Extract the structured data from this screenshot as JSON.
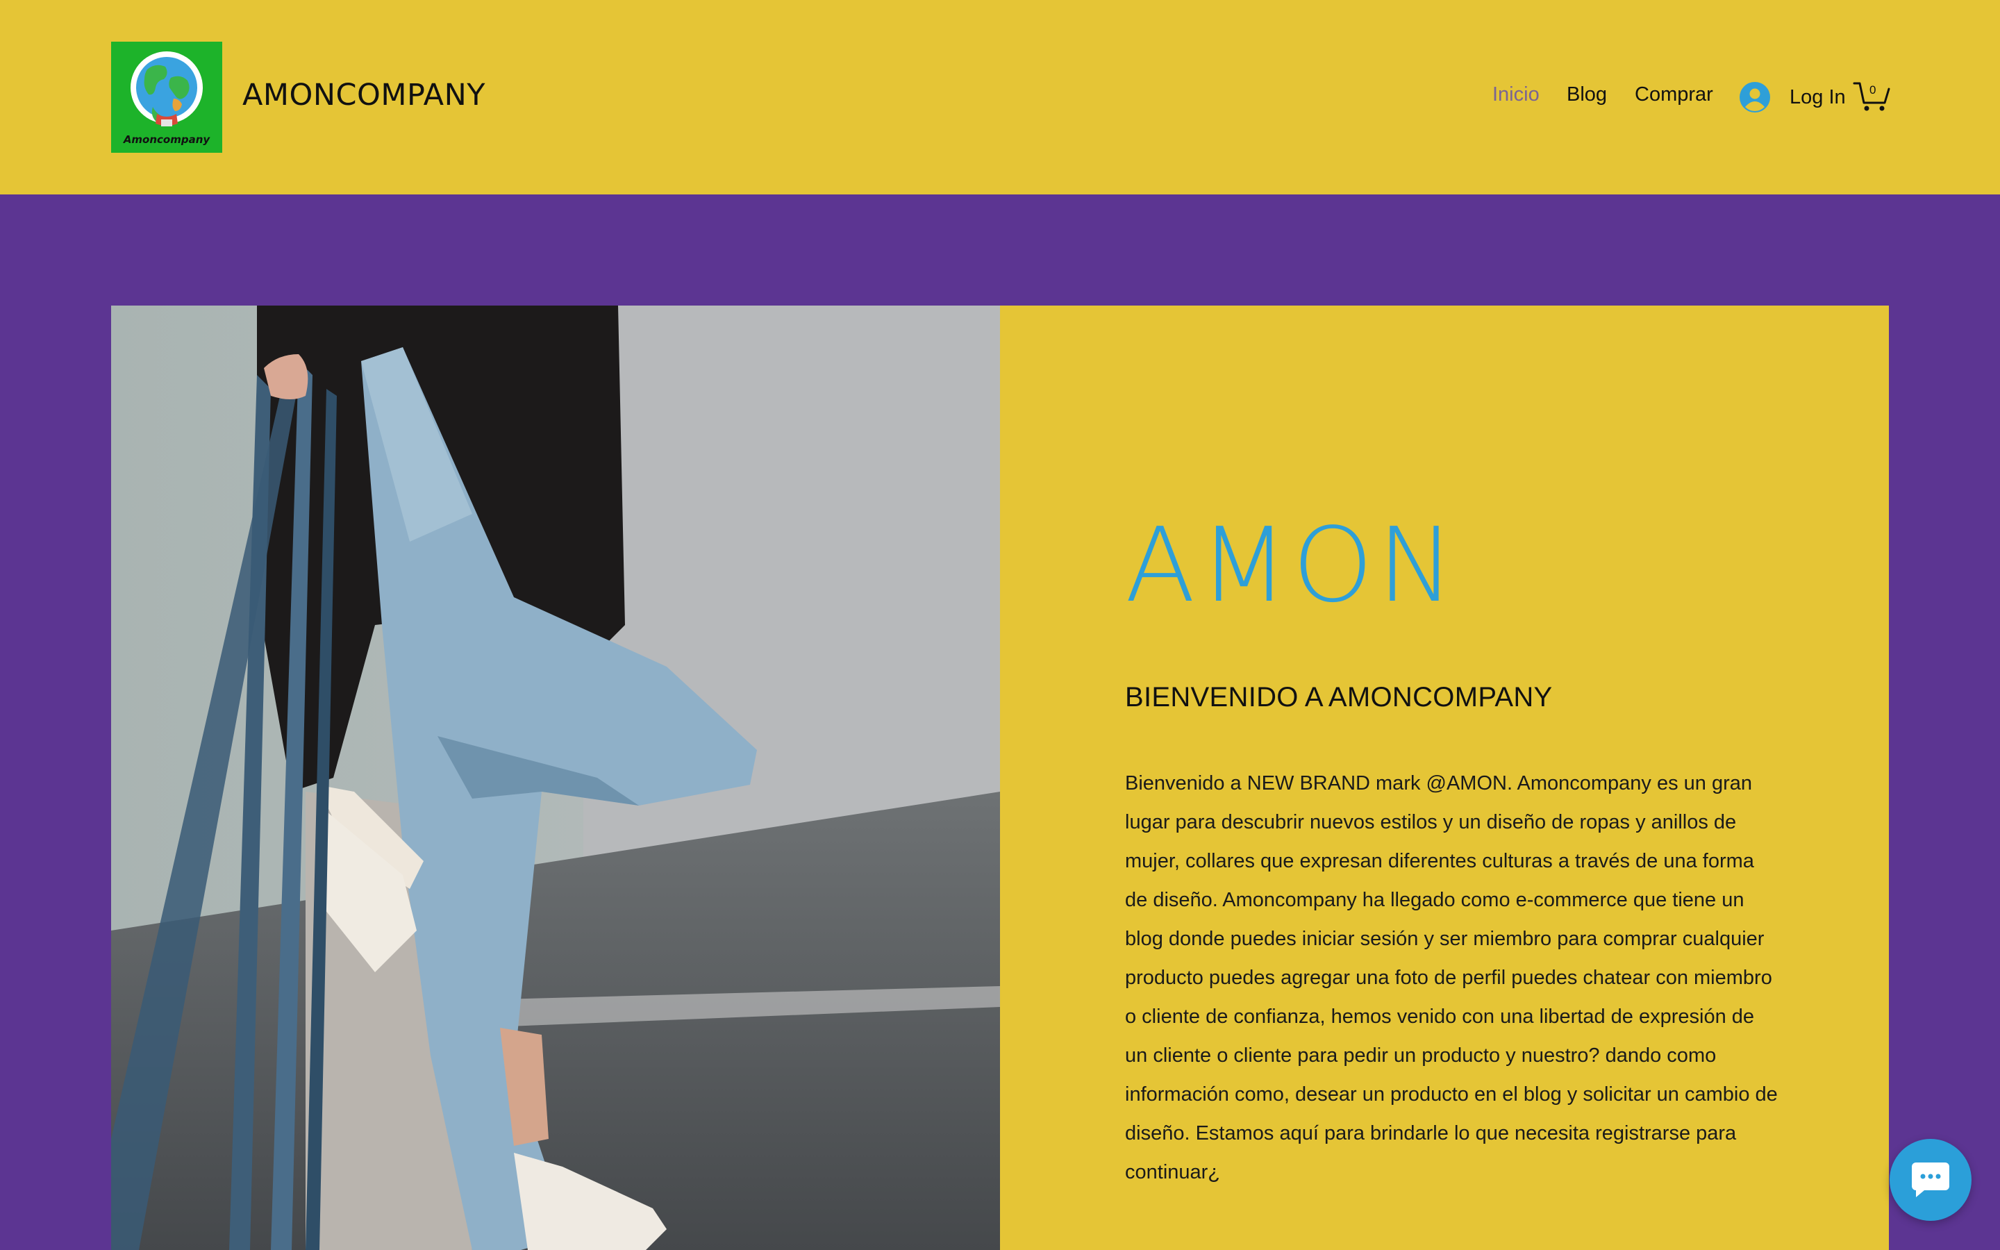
{
  "header": {
    "logo_text": "Amoncompany",
    "brand": "AMONCOMPANY",
    "nav": [
      {
        "label": "Inicio",
        "active": true
      },
      {
        "label": "Blog",
        "active": false
      },
      {
        "label": "Comprar",
        "active": false
      }
    ],
    "login_label": "Log In",
    "cart_count": "0"
  },
  "hero": {
    "title": "AMON",
    "subtitle": "BIENVENIDO A AMONCOMPANY",
    "body": "Bienvenido a NEW BRAND mark @AMON. Amoncompany es un gran lugar para descubrir nuevos estilos y un diseño de ropas y anillos de mujer, collares que expresan diferentes culturas a través de una forma de diseño. Amoncompany ha llegado como e-commerce que tiene un blog donde puedes iniciar sesión y ser miembro para comprar cualquier producto puedes agregar una foto de perfil puedes chatear con miembro o cliente de confianza, hemos venido con una libertad de expresión de un cliente o cliente para pedir un producto y nuestro? dando como información como, desear un producto en el blog y solicitar un cambio de diseño. Estamos aquí para brindarle lo que necesita registrarse para continuar¿"
  },
  "icons": {
    "logo": "globe-logo-icon",
    "avatar": "user-avatar-icon",
    "cart": "shopping-cart-icon",
    "chat": "chat-bubble-icon"
  },
  "colors": {
    "header_bg": "#e5c536",
    "page_bg": "#5c3592",
    "panel_bg": "#e5c536",
    "accent_blue": "#2e9fd8",
    "logo_green": "#1db32a",
    "nav_active": "#7a6494"
  }
}
